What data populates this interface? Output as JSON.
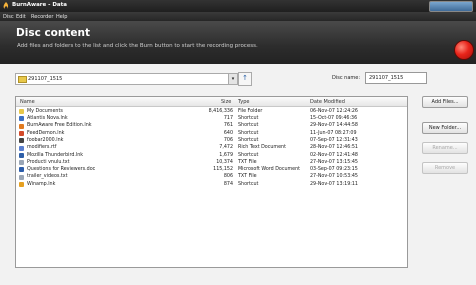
{
  "window": {
    "title": "BurnAware - Data"
  },
  "menu": [
    "Disc",
    "Edit",
    "Recorder",
    "Help"
  ],
  "header": {
    "title": "Disc content",
    "subtitle": "Add files and folders to the list and click the Burn button to start the recording process."
  },
  "path": {
    "value": "291107_1515"
  },
  "disc_name": {
    "label": "Disc name:",
    "value": "291107_1515"
  },
  "columns": {
    "name": "Name",
    "size": "Size",
    "type": "Type",
    "modified": "Date Modified"
  },
  "files": [
    {
      "name": "My Documents",
      "size": "8,416,336",
      "type": "File Folder",
      "modified": "06-Nov-07 12:24:26",
      "icon": "folder-icon",
      "color": "#e8c84a"
    },
    {
      "name": "Atlantis Nova.lnk",
      "size": "717",
      "type": "Shortcut",
      "modified": "15-Oct-07 09:46:36",
      "icon": "app-shortcut-icon",
      "color": "#3b6fc4"
    },
    {
      "name": "BurnAware Free Edition.lnk",
      "size": "761",
      "type": "Shortcut",
      "modified": "29-Nov-07 14:44:58",
      "icon": "burnaware-icon",
      "color": "#e07a20"
    },
    {
      "name": "FeedDemon.lnk",
      "size": "640",
      "type": "Shortcut",
      "modified": "11-Jun-07 08:27:09",
      "icon": "feed-icon",
      "color": "#d34a2a"
    },
    {
      "name": "foobar2000.lnk",
      "size": "706",
      "type": "Shortcut",
      "modified": "07-Sep-07 12:31:43",
      "icon": "player-icon",
      "color": "#444444"
    },
    {
      "name": "modifiers.rtf",
      "size": "7,472",
      "type": "Rich Text Document",
      "modified": "28-Nov-07 12:46:51",
      "icon": "document-icon",
      "color": "#5a7fd0"
    },
    {
      "name": "Mozilla Thunderbird.lnk",
      "size": "1,679",
      "type": "Shortcut",
      "modified": "02-Nov-07 12:41:48",
      "icon": "mail-icon",
      "color": "#2e5fa8"
    },
    {
      "name": "Producti vnulu.txt",
      "size": "10,374",
      "type": "TXT File",
      "modified": "27-Nov-07 13:15:45",
      "icon": "text-file-icon",
      "color": "#9aa6b6"
    },
    {
      "name": "Questions for Reviewers.doc",
      "size": "115,152",
      "type": "Microsoft Word Document",
      "modified": "03-Sep-07 09:23:15",
      "icon": "word-doc-icon",
      "color": "#2b5caa"
    },
    {
      "name": "trailer_videos.txt",
      "size": "806",
      "type": "TXT File",
      "modified": "27-Nov-07 10:53:45",
      "icon": "text-file-icon",
      "color": "#9aa6b6"
    },
    {
      "name": "Winamp.lnk",
      "size": "874",
      "type": "Shortcut",
      "modified": "29-Nov-07 13:19:11",
      "icon": "winamp-icon",
      "color": "#e6a020"
    }
  ],
  "buttons": {
    "add_files": "Add Files...",
    "new_folder": "New Folder...",
    "rename": "Rename...",
    "remove": "Remove"
  }
}
